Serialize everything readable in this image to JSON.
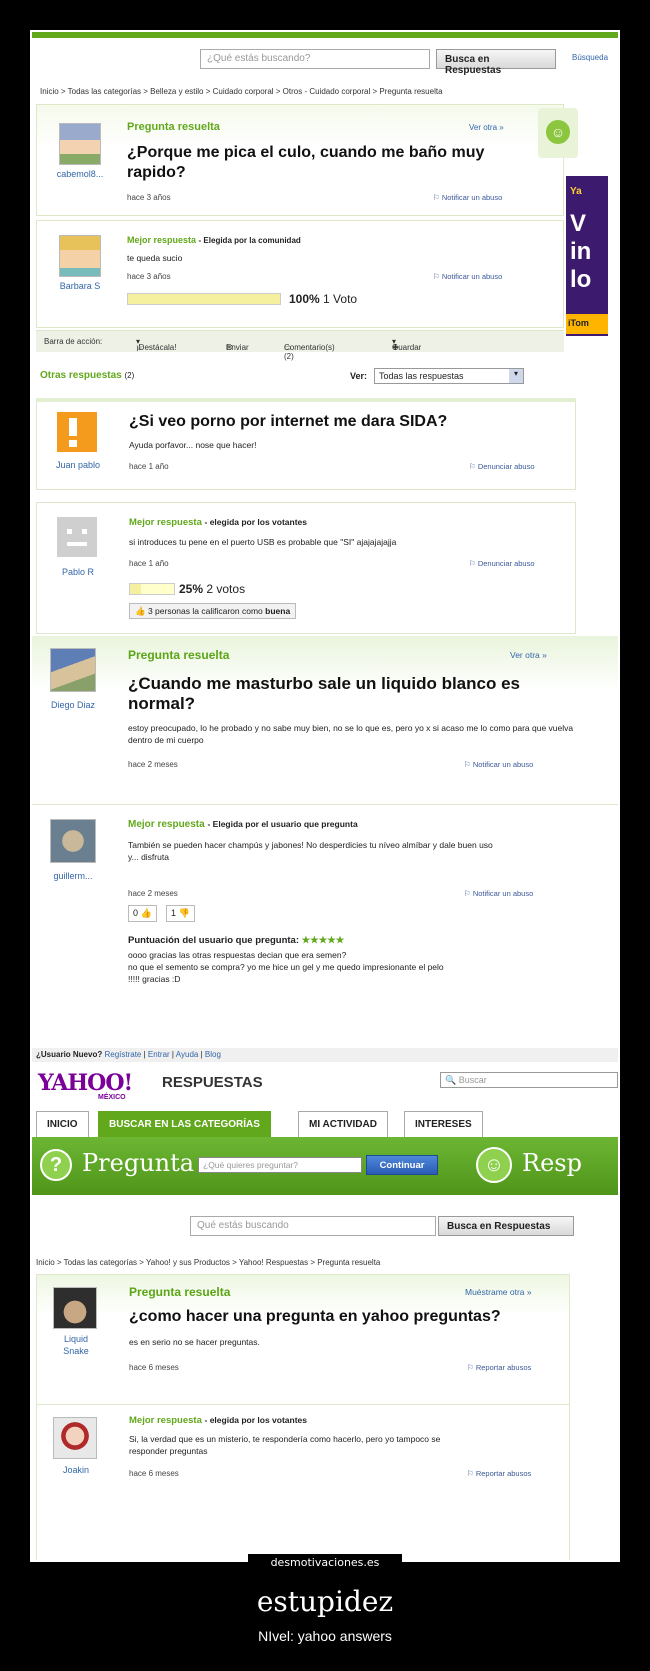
{
  "panel1": {
    "search_placeholder": "¿Qué estás buscando?",
    "search_button": "Busca en Respuestas",
    "search_tab": "Búsqueda",
    "breadcrumb": "Inicio > Todas las categorías > Belleza y estilo > Cuidado corporal > Otros - Cuidado corporal > Pregunta resuelta",
    "status": "Pregunta resuelta",
    "see_other": "Ver otra »",
    "question": "¿Porque me pica el culo, cuando me baño muy rapido?",
    "asker": "cabemol8...",
    "asked_time": "hace 3 años",
    "report": "Notificar un abuso",
    "best_label": "Mejor respuesta",
    "best_chosen": "- Elegida por la comunidad",
    "answer": "te queda sucio",
    "answerer": "Barbara S",
    "answer_time": "hace 3 años",
    "report2": "Notificar un abuso",
    "vote_pct": "100%",
    "vote_count": "1 Voto",
    "vote_fill": 1.0,
    "actions": {
      "label": "Barra de acción:",
      "highlight": "¡Destácala!",
      "send": "Enviar",
      "comments": "Comentario(s) (2)",
      "save": "Guardar"
    },
    "other_answers": "Otras respuestas",
    "other_count": "(2)",
    "view_label": "Ver:",
    "view_select": "Todas las respuestas",
    "ad_lines": [
      "Ya",
      "V",
      "in",
      "lo"
    ],
    "ad_button": "iTom"
  },
  "panel2": {
    "question": "¿Si veo porno por internet me dara SIDA?",
    "details": "Ayuda porfavor... nose que hacer!",
    "asker": "Juan pablo",
    "asked_time": "hace 1 año",
    "report": "Denunciar abuso",
    "best_label": "Mejor respuesta",
    "best_chosen": "- elegida por los votantes",
    "answer": "si introduces tu pene en el puerto USB es probable que \"SI\" ajajajajajja",
    "answerer": "Pablo R",
    "answer_time": "hace 1 año",
    "report2": "Denunciar abuso",
    "vote_pct": "25%",
    "vote_count": "2 votos",
    "vote_fill": 0.25,
    "rated_prefix": "3 personas la calificaron como",
    "rated_word": "buena"
  },
  "panel3": {
    "status": "Pregunta resuelta",
    "see_other": "Ver otra »",
    "question": "¿Cuando me masturbo sale un liquido blanco es normal?",
    "details": "estoy preocupado, lo he probado y no sabe muy bien, no se lo que es, pero yo x si acaso me lo como para que vuelva dentro de mi cuerpo",
    "asker": "Diego Diaz",
    "asked_time": "hace 2 meses",
    "report": "Notificar un abuso",
    "best_label": "Mejor respuesta",
    "best_chosen": "- Elegida por el usuario que pregunta",
    "answer_lines": [
      "También se pueden hacer champús y jabones! No desperdicies tu níveo almíbar y dale buen uso",
      "y... disfruta"
    ],
    "answerer": "guillerm...",
    "answer_time": "hace 2 meses",
    "report2": "Notificar un abuso",
    "thumbs_up": "0",
    "thumbs_down": "1",
    "rating_label": "Puntuación del usuario que pregunta:",
    "stars": "★★★★★",
    "comment_lines": [
      "oooo gracias las otras respuestas decian que era semen?",
      "no que el semento se compra? yo me hice un gel y me quedo impresionante el pelo",
      "!!!!! gracias :D"
    ]
  },
  "panel4": {
    "top_links": [
      "¿Usuario Nuevo?",
      "Regístrate",
      "Entrar",
      "Ayuda",
      "Blog"
    ],
    "logo": "YAHOO!",
    "logo_sub": "MÉXICO",
    "logo_section": "RESPUESTAS",
    "top_search": "Buscar",
    "tabs": [
      "INICIO",
      "BUSCAR EN LAS CATEGORÍAS",
      "MI ACTIVIDAD",
      "INTERESES"
    ],
    "ask_label": "Pregunta",
    "ask_placeholder": "¿Qué quieres preguntar?",
    "ask_button": "Continuar",
    "answer_label": "Resp",
    "search_placeholder": "Qué estás buscando",
    "search_button": "Busca en Respuestas",
    "breadcrumb": "Inicio > Todas las categorías > Yahoo! y sus Productos > Yahoo! Respuestas > Pregunta resuelta",
    "status": "Pregunta resuelta",
    "see_other": "Muéstrame otra »",
    "question": "¿como hacer una pregunta en yahoo preguntas?",
    "details": "es en serio no se hacer preguntas.",
    "asker_lines": [
      "Liquid",
      "Snake"
    ],
    "asked_time": "hace 6 meses",
    "report": "Reportar abusos",
    "best_label": "Mejor respuesta",
    "best_chosen": "- elegida por los votantes",
    "answer_lines": [
      "Si, la verdad que es un misterio, te respondería como hacerlo, pero yo tampoco se",
      "responder preguntas"
    ],
    "answerer": "Joakin",
    "answer_time": "hace 6 meses",
    "report2": "Reportar abusos"
  },
  "watermark": "desmotivaciones.es",
  "caption": {
    "title": "estupidez",
    "subtitle": "NIvel: yahoo answers"
  }
}
